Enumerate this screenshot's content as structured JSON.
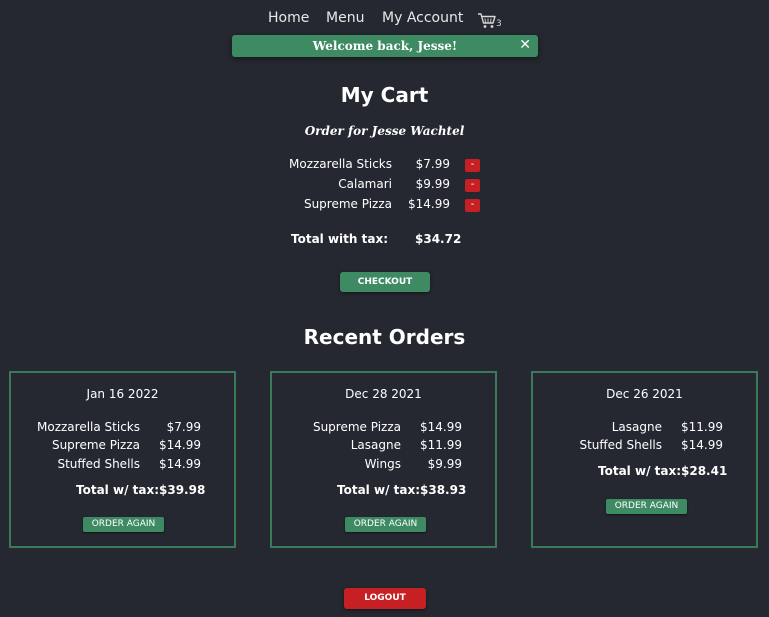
{
  "nav": {
    "home": "Home",
    "menu": "Menu",
    "account": "My Account",
    "cart_icon": "shopping-cart-icon",
    "cart_count": "3"
  },
  "toast": {
    "message": "Welcome back, Jesse!",
    "close": "✕"
  },
  "cart": {
    "title": "My Cart",
    "order_for": "Order for Jesse Wachtel",
    "items": [
      {
        "name": "Mozzarella Sticks",
        "price": "$7.99",
        "remove": "-"
      },
      {
        "name": "Calamari",
        "price": "$9.99",
        "remove": "-"
      },
      {
        "name": "Supreme Pizza",
        "price": "$14.99",
        "remove": "-"
      }
    ],
    "total_label": "Total with tax:",
    "total_value": "$34.72",
    "checkout": "CHECKOUT"
  },
  "recent": {
    "title": "Recent Orders",
    "orders": [
      {
        "date": "Jan 16 2022",
        "items": [
          {
            "name": "Mozzarella Sticks",
            "price": "$7.99"
          },
          {
            "name": "Supreme Pizza",
            "price": "$14.99"
          },
          {
            "name": "Stuffed Shells",
            "price": "$14.99"
          }
        ],
        "total_label": "Total w/ tax:",
        "total_value": "$39.98",
        "order_again": "ORDER AGAIN"
      },
      {
        "date": "Dec 28 2021",
        "items": [
          {
            "name": "Supreme Pizza",
            "price": "$14.99"
          },
          {
            "name": "Lasagne",
            "price": "$11.99"
          },
          {
            "name": "Wings",
            "price": "$9.99"
          }
        ],
        "total_label": "Total w/ tax:",
        "total_value": "$38.93",
        "order_again": "ORDER AGAIN"
      },
      {
        "date": "Dec 26 2021",
        "items": [
          {
            "name": "Lasagne",
            "price": "$11.99"
          },
          {
            "name": "Stuffed Shells",
            "price": "$14.99"
          }
        ],
        "total_label": "Total w/ tax:",
        "total_value": "$28.41",
        "order_again": "ORDER AGAIN"
      }
    ]
  },
  "logout": "LOGOUT",
  "colors": {
    "background": "#252830",
    "accent_green": "#3e8a63",
    "danger_red": "#c62024",
    "card_border": "#3a7a58"
  }
}
